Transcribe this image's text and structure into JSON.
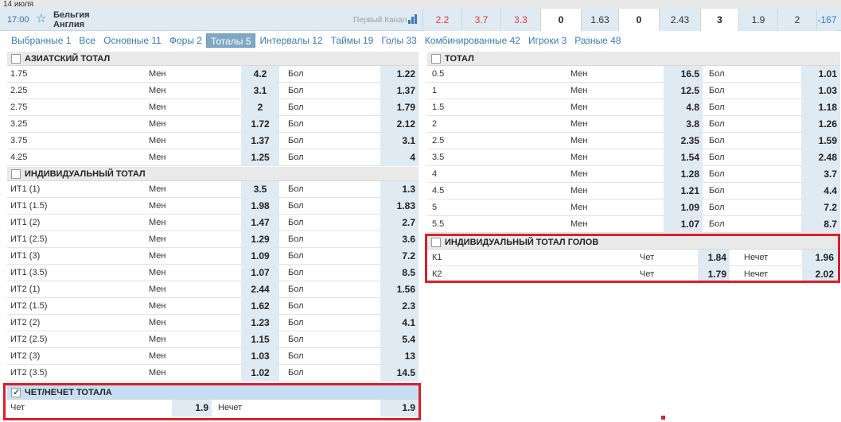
{
  "date": "14 июля",
  "match": {
    "time": "17:00",
    "team1": "Бельгия",
    "team2": "Англия",
    "tv": "Первый Канал",
    "odds": [
      {
        "value": "2.2",
        "style": "red"
      },
      {
        "value": "3.7",
        "style": "red"
      },
      {
        "value": "3.3",
        "style": "red"
      },
      {
        "value": "0",
        "style": "white"
      },
      {
        "value": "1.63",
        "style": "plain"
      },
      {
        "value": "0",
        "style": "white"
      },
      {
        "value": "2.43",
        "style": "plain"
      },
      {
        "value": "3",
        "style": "white"
      },
      {
        "value": "1.9",
        "style": "plain"
      },
      {
        "value": "2",
        "style": "plain"
      },
      {
        "value": "-167",
        "style": "blue"
      }
    ]
  },
  "tabs": [
    {
      "label": "Выбранные 1"
    },
    {
      "label": "Все"
    },
    {
      "label": "Основные 11"
    },
    {
      "label": "Форы 2"
    },
    {
      "label": "Тоталы 5",
      "active": true
    },
    {
      "label": "Интервалы 12"
    },
    {
      "label": "Таймы 19"
    },
    {
      "label": "Голы 33"
    },
    {
      "label": "Комбинированные 42"
    },
    {
      "label": "Игроки 3"
    },
    {
      "label": "Разные 48"
    }
  ],
  "asian_total": {
    "title": "АЗИАТСКИЙ ТОТАЛ",
    "rows": [
      {
        "name": "1.75",
        "a": "Мен",
        "ac": "4.2",
        "b": "Бол",
        "bc": "1.22"
      },
      {
        "name": "2.25",
        "a": "Мен",
        "ac": "3.1",
        "b": "Бол",
        "bc": "1.37"
      },
      {
        "name": "2.75",
        "a": "Мен",
        "ac": "2",
        "b": "Бол",
        "bc": "1.79"
      },
      {
        "name": "3.25",
        "a": "Мен",
        "ac": "1.72",
        "b": "Бол",
        "bc": "2.12"
      },
      {
        "name": "3.75",
        "a": "Мен",
        "ac": "1.37",
        "b": "Бол",
        "bc": "3.1"
      },
      {
        "name": "4.25",
        "a": "Мен",
        "ac": "1.25",
        "b": "Бол",
        "bc": "4"
      }
    ]
  },
  "individual_total": {
    "title": "ИНДИВИДУАЛЬНЫЙ ТОТАЛ",
    "rows": [
      {
        "name": "ИТ1 (1)",
        "a": "Мен",
        "ac": "3.5",
        "b": "Бол",
        "bc": "1.3"
      },
      {
        "name": "ИТ1 (1.5)",
        "a": "Мен",
        "ac": "1.98",
        "b": "Бол",
        "bc": "1.83"
      },
      {
        "name": "ИТ1 (2)",
        "a": "Мен",
        "ac": "1.47",
        "b": "Бол",
        "bc": "2.7"
      },
      {
        "name": "ИТ1 (2.5)",
        "a": "Мен",
        "ac": "1.29",
        "b": "Бол",
        "bc": "3.6"
      },
      {
        "name": "ИТ1 (3)",
        "a": "Мен",
        "ac": "1.09",
        "b": "Бол",
        "bc": "7.2"
      },
      {
        "name": "ИТ1 (3.5)",
        "a": "Мен",
        "ac": "1.07",
        "b": "Бол",
        "bc": "8.5"
      },
      {
        "name": "ИТ2 (1)",
        "a": "Мен",
        "ac": "2.44",
        "b": "Бол",
        "bc": "1.56"
      },
      {
        "name": "ИТ2 (1.5)",
        "a": "Мен",
        "ac": "1.62",
        "b": "Бол",
        "bc": "2.3"
      },
      {
        "name": "ИТ2 (2)",
        "a": "Мен",
        "ac": "1.23",
        "b": "Бол",
        "bc": "4.1"
      },
      {
        "name": "ИТ2 (2.5)",
        "a": "Мен",
        "ac": "1.15",
        "b": "Бол",
        "bc": "5.4"
      },
      {
        "name": "ИТ2 (3)",
        "a": "Мен",
        "ac": "1.03",
        "b": "Бол",
        "bc": "13"
      },
      {
        "name": "ИТ2 (3.5)",
        "a": "Мен",
        "ac": "1.02",
        "b": "Бол",
        "bc": "14.5"
      }
    ]
  },
  "odd_even_total": {
    "title": "ЧЕТ/НЕЧЕТ ТОТАЛА",
    "checked": true,
    "row": {
      "a": "Чет",
      "ac": "1.9",
      "b": "Нечет",
      "bc": "1.9"
    }
  },
  "total": {
    "title": "ТОТАЛ",
    "rows": [
      {
        "name": "0.5",
        "a": "Мен",
        "ac": "16.5",
        "b": "Бол",
        "bc": "1.01"
      },
      {
        "name": "1",
        "a": "Мен",
        "ac": "12.5",
        "b": "Бол",
        "bc": "1.03"
      },
      {
        "name": "1.5",
        "a": "Мен",
        "ac": "4.8",
        "b": "Бол",
        "bc": "1.18"
      },
      {
        "name": "2",
        "a": "Мен",
        "ac": "3.8",
        "b": "Бол",
        "bc": "1.26"
      },
      {
        "name": "2.5",
        "a": "Мен",
        "ac": "2.35",
        "b": "Бол",
        "bc": "1.59"
      },
      {
        "name": "3.5",
        "a": "Мен",
        "ac": "1.54",
        "b": "Бол",
        "bc": "2.48"
      },
      {
        "name": "4",
        "a": "Мен",
        "ac": "1.28",
        "b": "Бол",
        "bc": "3.7"
      },
      {
        "name": "4.5",
        "a": "Мен",
        "ac": "1.21",
        "b": "Бол",
        "bc": "4.4"
      },
      {
        "name": "5",
        "a": "Мен",
        "ac": "1.09",
        "b": "Бол",
        "bc": "7.2"
      },
      {
        "name": "5.5",
        "a": "Мен",
        "ac": "1.07",
        "b": "Бол",
        "bc": "8.7"
      }
    ]
  },
  "individual_goals_total": {
    "title": "ИНДИВИДУАЛЬНЫЙ ТОТАЛ ГОЛОВ",
    "rows": [
      {
        "name": "К1",
        "a": "Чет",
        "ac": "1.84",
        "b": "Нечет",
        "bc": "1.96"
      },
      {
        "name": "К2",
        "a": "Чет",
        "ac": "1.79",
        "b": "Нечет",
        "bc": "2.02"
      }
    ]
  },
  "colors": {
    "accent": "#3a7ab8",
    "odd_cell": "#dfeaf3",
    "highlight": "#d9202a",
    "header_bg": "#dfeaf3"
  }
}
